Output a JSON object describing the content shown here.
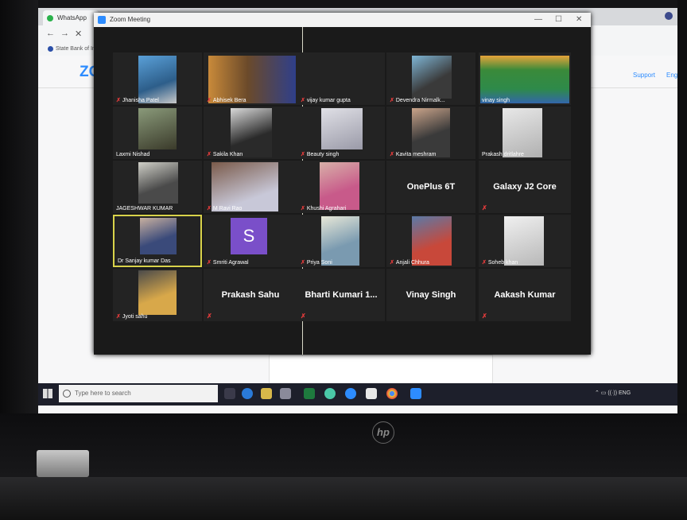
{
  "browser": {
    "tab_title": "WhatsApp",
    "nav": {
      "back": "←",
      "forward": "→",
      "close": "✕"
    },
    "bookmark": "State Bank of Ind"
  },
  "zoom_site": {
    "logo": "ZO",
    "support": "Support",
    "english": "English"
  },
  "zoom_window": {
    "title": "Zoom Meeting",
    "controls": {
      "minimize": "—",
      "maximize": "☐",
      "close": "✕"
    }
  },
  "participants": [
    {
      "name": "Jhanisha Patel",
      "muted": true
    },
    {
      "name": "Abhisek Bera",
      "muted": true
    },
    {
      "name": "vijay kumar gupta",
      "muted": true
    },
    {
      "name": "Devendra Nirmalk...",
      "muted": true
    },
    {
      "name": "vinay singh",
      "muted": false
    },
    {
      "name": "Laxmi Nishad",
      "muted": false
    },
    {
      "name": "Sakila Khan",
      "muted": true
    },
    {
      "name": "Beauty singh",
      "muted": true
    },
    {
      "name": "Kavita meshram",
      "muted": true
    },
    {
      "name": "Prakash dritlahre",
      "muted": false
    },
    {
      "name": "JAGESHWAR KUMAR",
      "muted": false
    },
    {
      "name": "M Ravi Rao",
      "muted": true
    },
    {
      "name": "Khushi Agrahari",
      "muted": true
    },
    {
      "name": "OnePlus 6T",
      "muted": false
    },
    {
      "name": "Galaxy J2 Core",
      "muted": true
    },
    {
      "name": "Dr Sanjay kumar Das",
      "muted": false
    },
    {
      "name": "Smriti Agrawal",
      "muted": true,
      "avatar": "S"
    },
    {
      "name": "Priya Soni",
      "muted": true
    },
    {
      "name": "Anjali Chhura",
      "muted": true
    },
    {
      "name": "Soheb khan",
      "muted": true
    },
    {
      "name": "Jyoti sahu",
      "muted": true
    },
    {
      "name": "Prakash Sahu",
      "muted": true
    },
    {
      "name": "Bharti Kumari 1...",
      "muted": true
    },
    {
      "name": "Vinay Singh",
      "muted": false
    },
    {
      "name": "Aakash Kumar",
      "muted": true
    }
  ],
  "taskbar": {
    "search_placeholder": "Type here to search",
    "tray_lang": "ENG"
  },
  "brand": {
    "logo": "hp"
  },
  "colors": {
    "active_speaker": "#d8d24a",
    "zoom_blue": "#2d8cff",
    "muted_red": "#e23b3b"
  }
}
